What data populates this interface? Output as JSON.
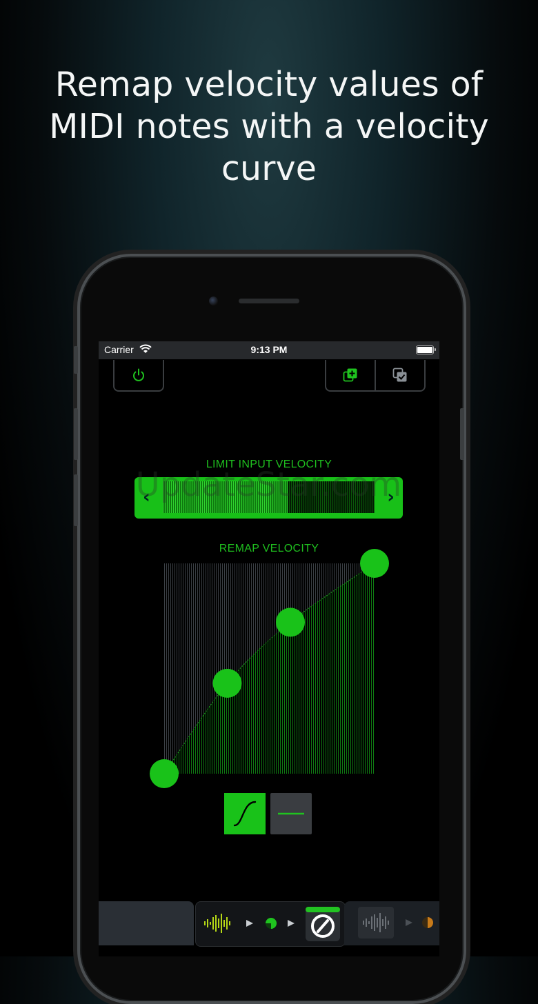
{
  "headline": "Remap velocity values of MIDI notes with a velocity curve",
  "status": {
    "carrier": "Carrier",
    "time": "9:13 PM"
  },
  "icons": {
    "power": "power-icon",
    "add_preset": "add-preset-icon",
    "select_presets": "select-presets-icon",
    "wifi": "wifi-icon",
    "battery": "battery-icon"
  },
  "limit": {
    "label": "LIMIT INPUT VELOCITY",
    "left_arrow": "‹",
    "right_arrow": "›",
    "fill_fraction": 0.59
  },
  "remap": {
    "label": "REMAP VELOCITY"
  },
  "watermark": "UpdateStar.com",
  "curve": {
    "type": "velocity-curve",
    "x": [
      0,
      30,
      60,
      100
    ],
    "y": [
      0,
      43,
      72,
      100
    ],
    "xlim": [
      0,
      100
    ],
    "ylim": [
      0,
      100
    ]
  },
  "colors": {
    "accent": "#19c219",
    "dark_accent": "#0a5a0a",
    "background": "#000000",
    "panel": "#27292c"
  }
}
